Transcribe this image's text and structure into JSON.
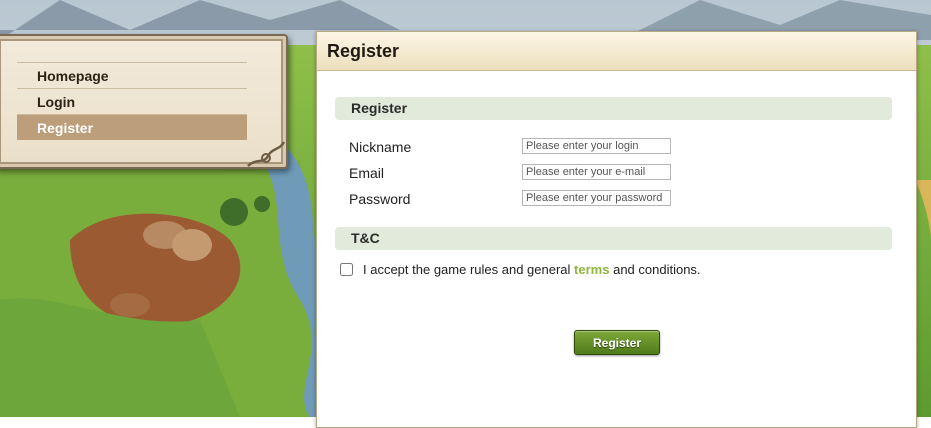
{
  "menu": {
    "items": [
      {
        "label": "Homepage",
        "active": false
      },
      {
        "label": "Login",
        "active": false
      },
      {
        "label": "Register",
        "active": true
      }
    ]
  },
  "main": {
    "title": "Register",
    "register_section": {
      "title": "Register",
      "fields": [
        {
          "label": "Nickname",
          "placeholder": "Please enter your login",
          "value": ""
        },
        {
          "label": "Email",
          "placeholder": "Please enter your e-mail",
          "value": ""
        },
        {
          "label": "Password",
          "placeholder": "Please enter your password",
          "value": ""
        }
      ]
    },
    "tc_section": {
      "title": "T&C",
      "text_before": "I accept the game rules and general",
      "terms_link": "terms",
      "text_after": "and conditions.",
      "checked": false
    },
    "submit_label": "Register"
  },
  "colors": {
    "menu_active": "#bd9e7a",
    "section_bar": "#e2eadb",
    "terms_link": "#8fb53a",
    "button_green": "#5d8a22"
  }
}
